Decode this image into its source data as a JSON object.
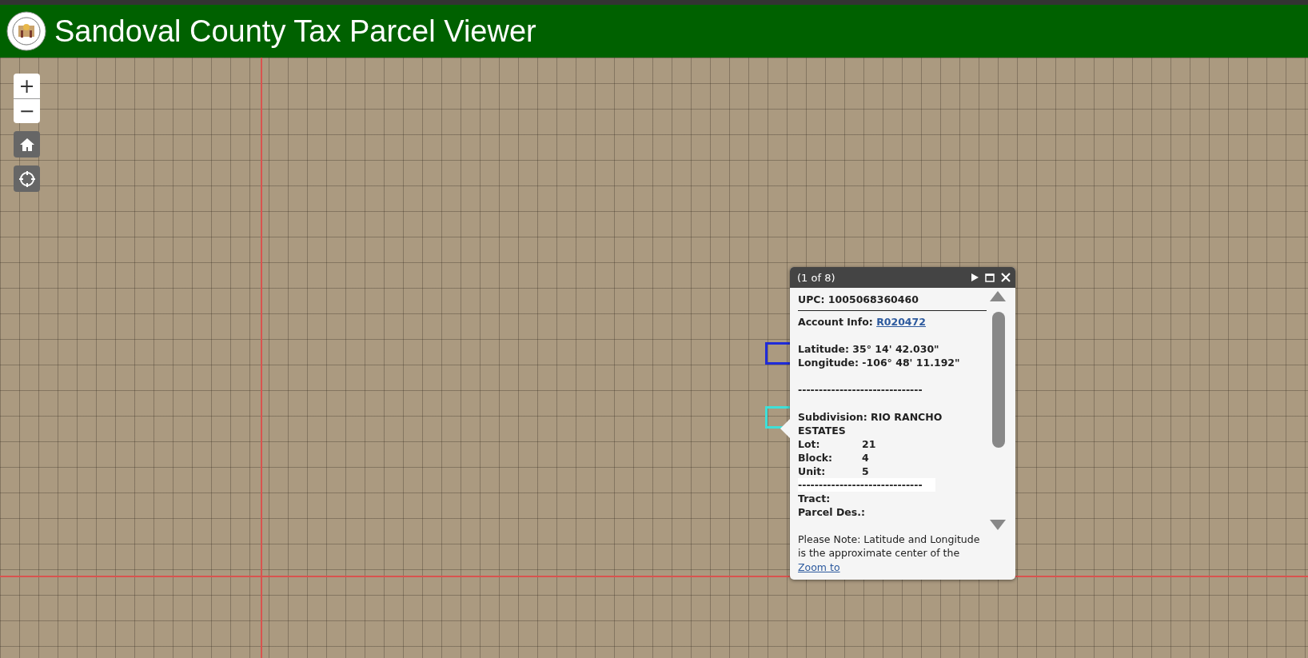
{
  "header": {
    "title": "Sandoval County Tax Parcel Viewer"
  },
  "map_controls": {
    "zoom_in": "+",
    "zoom_out": "−"
  },
  "popup": {
    "counter": "(1 of 8)",
    "upc": "UPC: 1005068360460",
    "account_label": "Account Info: ",
    "account_link": "R020472",
    "latitude": "Latitude: 35° 14' 42.030\"",
    "longitude": "Longitude: -106° 48' 11.192\"",
    "separator_1": "------------------------------",
    "subdivision": "Subdivision: RIO RANCHO ESTATES",
    "details": [
      {
        "label": "Lot:",
        "value": "21"
      },
      {
        "label": "Block:",
        "value": "4"
      },
      {
        "label": "Unit:",
        "value": "5"
      }
    ],
    "separator_2": "------------------------------",
    "tract": "Tract:",
    "parcel_des": "Parcel Des.:",
    "note": "Please Note: Latitude and Longitude is the approximate center of the",
    "zoom_link": "Zoom to"
  }
}
